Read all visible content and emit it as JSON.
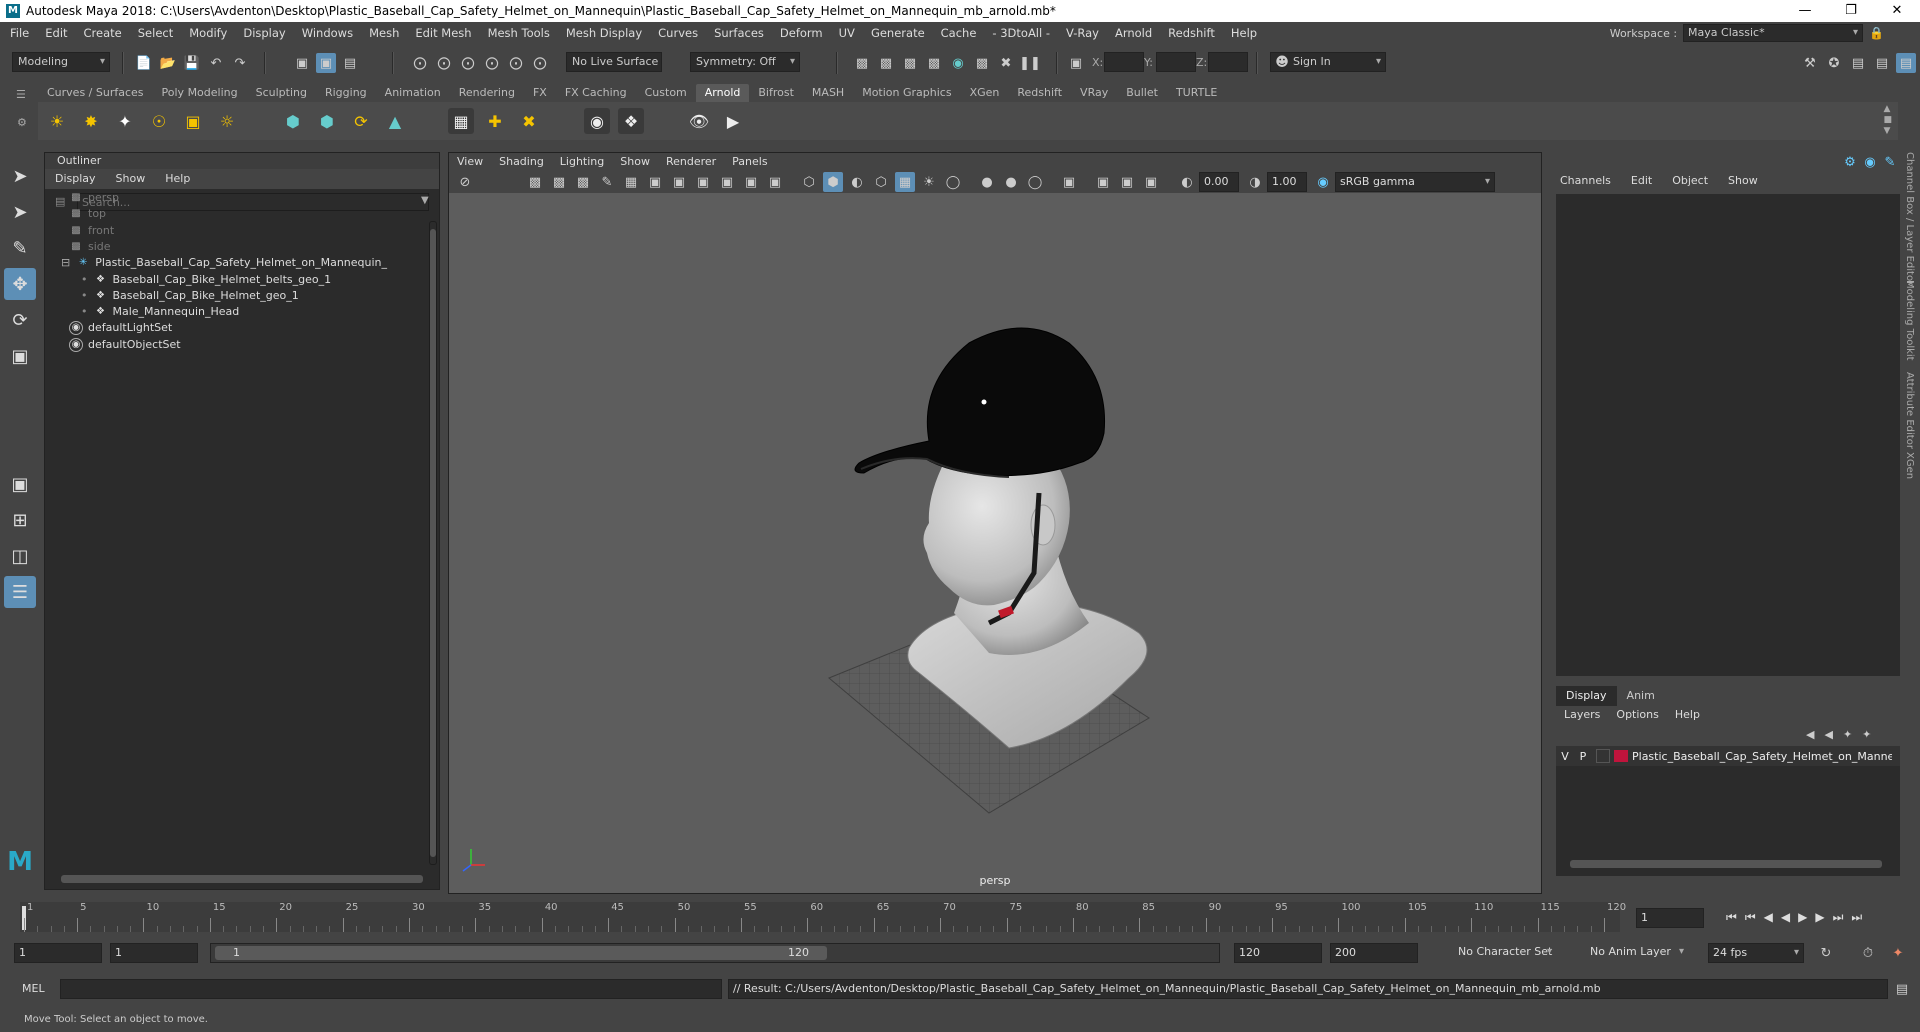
{
  "title": "Autodesk Maya 2018: C:\\Users\\Avdenton\\Desktop\\Plastic_Baseball_Cap_Safety_Helmet_on_Mannequin\\Plastic_Baseball_Cap_Safety_Helmet_on_Mannequin_mb_arnold.mb*",
  "menubar": {
    "items": [
      "File",
      "Edit",
      "Create",
      "Select",
      "Modify",
      "Display",
      "Windows",
      "Mesh",
      "Edit Mesh",
      "Mesh Tools",
      "Mesh Display",
      "Curves",
      "Surfaces",
      "Deform",
      "UV",
      "Generate",
      "Cache",
      "- 3DtoAll -",
      "V-Ray",
      "Arnold",
      "Redshift",
      "Help"
    ],
    "workspace_label": "Workspace :",
    "workspace_value": "Maya Classic*"
  },
  "statusline": {
    "mode": "Modeling",
    "live_surface": "No Live Surface",
    "symmetry": "Symmetry: Off",
    "x_label": "X:",
    "y_label": "Y:",
    "z_label": "Z:",
    "sign_in": "Sign In"
  },
  "shelf": {
    "tabs": [
      "Curves / Surfaces",
      "Poly Modeling",
      "Sculpting",
      "Rigging",
      "Animation",
      "Rendering",
      "FX",
      "FX Caching",
      "Custom",
      "Arnold",
      "Bifrost",
      "MASH",
      "Motion Graphics",
      "XGen",
      "Redshift",
      "VRay",
      "Bullet",
      "TURTLE"
    ],
    "active_tab": "Arnold"
  },
  "outliner": {
    "title": "Outliner",
    "menu": [
      "Display",
      "Show",
      "Help"
    ],
    "search_placeholder": "Search...",
    "items": [
      {
        "label": "persp",
        "kind": "camera"
      },
      {
        "label": "top",
        "kind": "camera"
      },
      {
        "label": "front",
        "kind": "camera"
      },
      {
        "label": "side",
        "kind": "camera"
      },
      {
        "label": "Plastic_Baseball_Cap_Safety_Helmet_on_Mannequin_",
        "kind": "group"
      },
      {
        "label": "Baseball_Cap_Bike_Helmet_belts_geo_1",
        "kind": "mesh"
      },
      {
        "label": "Baseball_Cap_Bike_Helmet_geo_1",
        "kind": "mesh"
      },
      {
        "label": "Male_Mannequin_Head",
        "kind": "mesh"
      },
      {
        "label": "defaultLightSet",
        "kind": "set"
      },
      {
        "label": "defaultObjectSet",
        "kind": "set"
      }
    ]
  },
  "viewport": {
    "menu": [
      "View",
      "Shading",
      "Lighting",
      "Show",
      "Renderer",
      "Panels"
    ],
    "exposure": "0.00",
    "gamma": "1.00",
    "color_space": "sRGB gamma",
    "camera_label": "persp"
  },
  "channelbox": {
    "menu": [
      "Channels",
      "Edit",
      "Object",
      "Show"
    ],
    "layer_tabs": [
      "Display",
      "Anim"
    ],
    "layer_menu": [
      "Layers",
      "Options",
      "Help"
    ],
    "layer": {
      "v": "V",
      "p": "P",
      "name": "Plastic_Baseball_Cap_Safety_Helmet_on_Mannequin",
      "color": "#c0143c"
    },
    "side_tabs": [
      "Channel Box / Layer Editor",
      "Modeling Toolkit",
      "Attribute Editor",
      "XGen"
    ]
  },
  "timeslider": {
    "ticks": [
      "1",
      "5",
      "10",
      "15",
      "20",
      "25",
      "30",
      "35",
      "40",
      "45",
      "50",
      "55",
      "60",
      "65",
      "70",
      "75",
      "80",
      "85",
      "90",
      "95",
      "100",
      "105",
      "110",
      "115",
      "120"
    ],
    "current_frame": "1"
  },
  "rangebar": {
    "start": "1",
    "playback_start": "1",
    "range_start": "1",
    "range_end": "120",
    "playback_end": "120",
    "end": "200",
    "character_set": "No Character Set",
    "anim_layer": "No Anim Layer",
    "fps": "24 fps"
  },
  "cmdline": {
    "lang": "MEL",
    "result": "// Result: C:/Users/Avdenton/Desktop/Plastic_Baseball_Cap_Safety_Helmet_on_Mannequin/Plastic_Baseball_Cap_Safety_Helmet_on_Mannequin_mb_arnold.mb"
  },
  "helpline": "Move Tool: Select an object to move."
}
